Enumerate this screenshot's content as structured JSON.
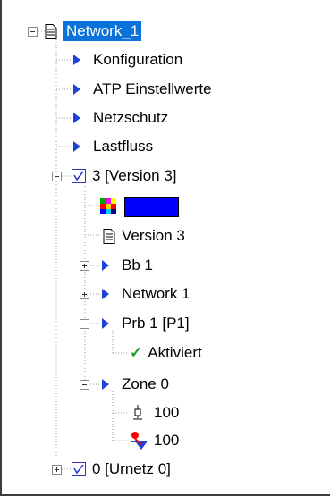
{
  "tree": {
    "root_label": "Network_1",
    "items": {
      "konfiguration": "Konfiguration",
      "atp": "ATP Einstellwerte",
      "netzschutz": "Netzschutz",
      "lastfluss": "Lastfluss",
      "version3_root": "3 [Version 3]",
      "version3_doc": "Version 3",
      "bb1": "Bb 1",
      "network1": "Network 1",
      "prb1": "Prb 1 [P1]",
      "aktiviert": "Aktiviert",
      "zone0": "Zone 0",
      "val_a": "100",
      "val_b": "100",
      "urnetz": "0 [Urnetz 0]"
    }
  },
  "colors": {
    "selection": "#0a72d8",
    "arrow": "#1d43d6",
    "check": "#1f9b33",
    "version_icon": "#2a36c8"
  }
}
